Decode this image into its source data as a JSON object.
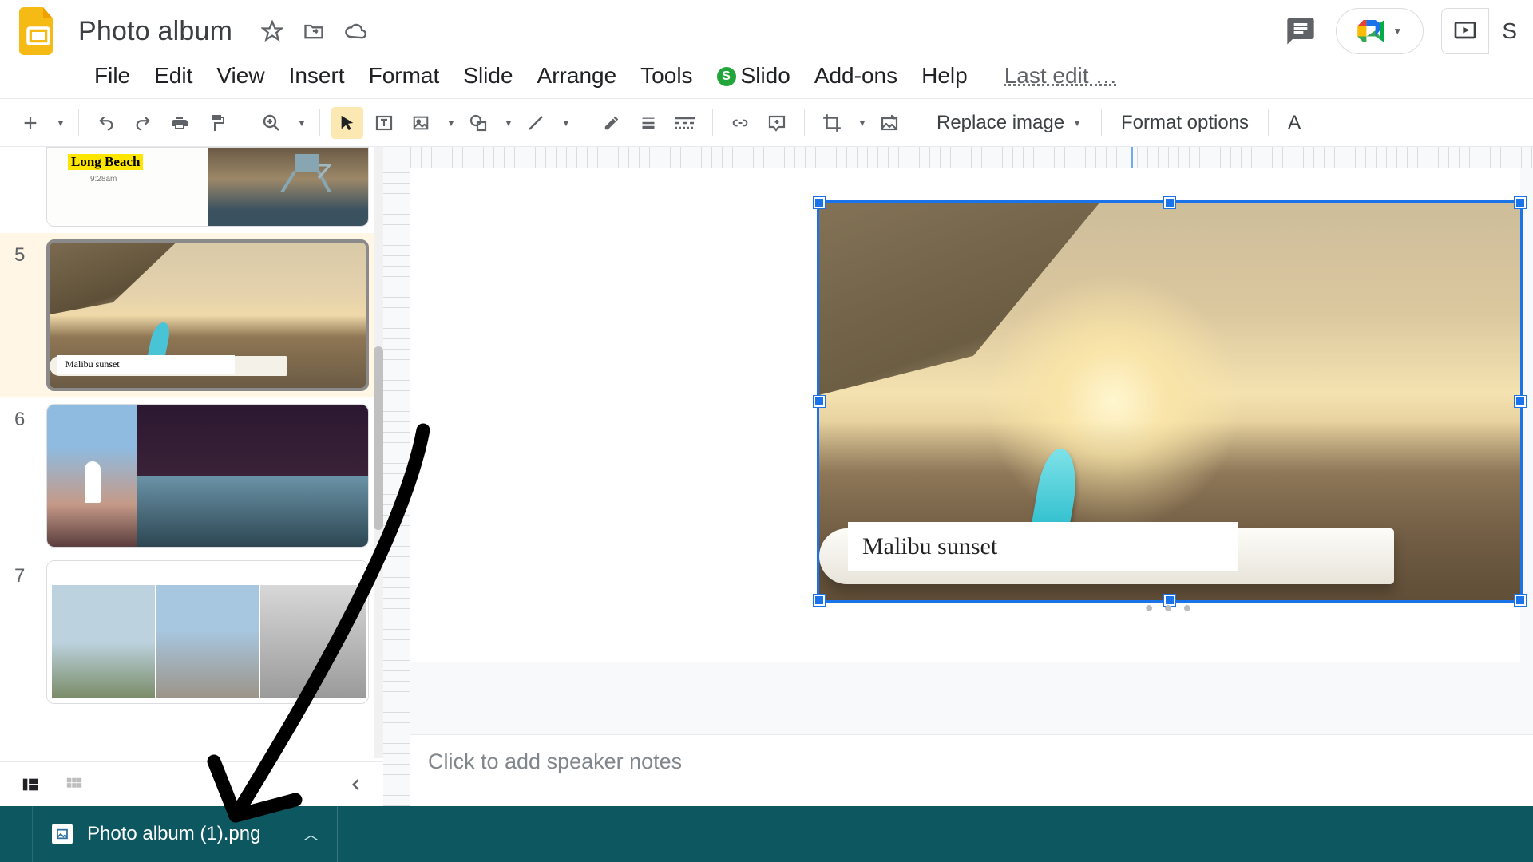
{
  "header": {
    "doc_title": "Photo album",
    "last_edit": "Last edit …"
  },
  "menus": {
    "file": "File",
    "edit": "Edit",
    "view": "View",
    "insert": "Insert",
    "format": "Format",
    "slide": "Slide",
    "arrange": "Arrange",
    "tools": "Tools",
    "slido": "Slido",
    "addons": "Add-ons",
    "help": "Help"
  },
  "toolbar": {
    "replace_image": "Replace image",
    "format_options": "Format options",
    "animate_initial": "A"
  },
  "filmstrip": {
    "slides": [
      {
        "num": "",
        "label": "Long Beach",
        "sub": "9:28am"
      },
      {
        "num": "5",
        "label": "Malibu sunset"
      },
      {
        "num": "6"
      },
      {
        "num": "7"
      }
    ]
  },
  "canvas": {
    "caption": "Malibu sunset",
    "notes_placeholder": "Click to add speaker notes"
  },
  "download": {
    "filename": "Photo album (1).png"
  },
  "present_initial": "S"
}
